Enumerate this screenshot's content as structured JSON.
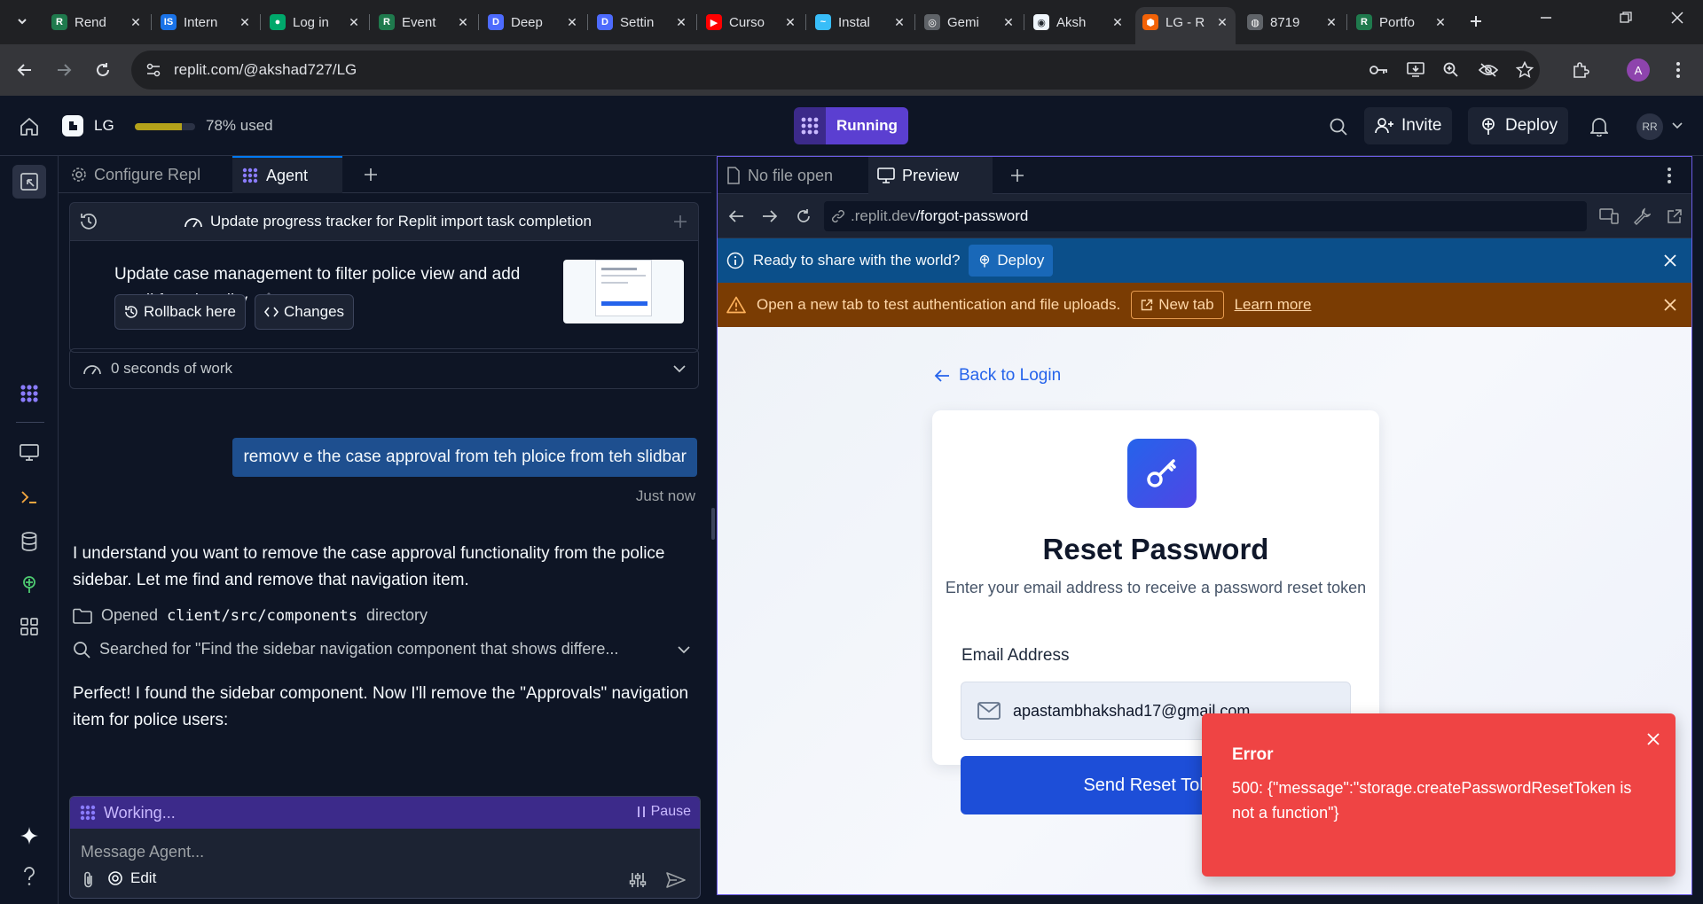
{
  "browser": {
    "tabs": [
      {
        "label": "Rend",
        "favicon_color": "#1f7a4d",
        "favicon_char": "R"
      },
      {
        "label": "Intern",
        "favicon_color": "#1a73e8",
        "favicon_char": "IS"
      },
      {
        "label": "Log in",
        "favicon_color": "#00a86b",
        "favicon_char": "●"
      },
      {
        "label": "Event",
        "favicon_color": "#1f7a4d",
        "favicon_char": "R"
      },
      {
        "label": "Deep",
        "favicon_color": "#4d6bfe",
        "favicon_char": "D"
      },
      {
        "label": "Settin",
        "favicon_color": "#4d6bfe",
        "favicon_char": "D"
      },
      {
        "label": "Curso",
        "favicon_color": "#ff0000",
        "favicon_char": "▶"
      },
      {
        "label": "Instal",
        "favicon_color": "#38bdf8",
        "favicon_char": "~"
      },
      {
        "label": "Gemi",
        "favicon_color": "#5f6368",
        "favicon_char": "◎"
      },
      {
        "label": "Aksh",
        "favicon_color": "#f0f6fc",
        "favicon_char": "◉"
      },
      {
        "label": "LG - R",
        "favicon_color": "#f26207",
        "favicon_char": "⬢",
        "active": true
      },
      {
        "label": "8719",
        "favicon_color": "#5f6368",
        "favicon_char": "◍"
      },
      {
        "label": "Portfo",
        "favicon_color": "#1f7a4d",
        "favicon_char": "R"
      }
    ],
    "url": "replit.com/@akshad727/LG",
    "profile_initial": "A"
  },
  "header": {
    "repl_name": "LG",
    "usage_percent": 78,
    "usage_text": "78% used",
    "run_label": "Running",
    "invite_label": "Invite",
    "deploy_label": "Deploy",
    "user_initials": "RR"
  },
  "left_pane": {
    "tabs": [
      {
        "label": "Configure Repl"
      },
      {
        "label": "Agent"
      }
    ],
    "top_task": "Update progress tracker for Replit import task completion",
    "checkpoint_text": "Update case management to filter police view and add scroll functionality",
    "rollback_label": "Rollback here",
    "changes_label": "Changes",
    "work_label": "0 seconds of work",
    "user_message": "removv e the case approval from teh ploice from teh slidbar",
    "message_time": "Just now",
    "agent_msg_1": "I understand you want to remove the case approval functionality from the police sidebar. Let me find and remove that navigation item.",
    "action_opened_prefix": "Opened",
    "action_opened_path": "client/src/components",
    "action_opened_suffix": "directory",
    "action_search": "Searched for \"Find the sidebar navigation component that shows differe...",
    "agent_msg_2": "Perfect! I found the sidebar component. Now I'll remove the \"Approvals\" navigation item for police users:",
    "working_label": "Working...",
    "pause_label": "Pause",
    "input_placeholder": "Message Agent...",
    "edit_label": "Edit"
  },
  "right_pane": {
    "tabs": [
      {
        "label": "No file open"
      },
      {
        "label": "Preview"
      }
    ],
    "url_prefix": ".replit.dev",
    "url_path": "/forgot-password",
    "share_text": "Ready to share with the world?",
    "share_deploy": "Deploy",
    "warn_text": "Open a new tab to test authentication and file uploads.",
    "newtab_label": "New tab",
    "learn_more": "Learn more"
  },
  "app": {
    "back_label": "Back to Login",
    "title": "Reset Password",
    "subtitle": "Enter your email address to receive a password reset token",
    "email_label": "Email Address",
    "email_value": "apastambhakshad17@gmail.com",
    "send_label": "Send Reset Token"
  },
  "toast": {
    "title": "Error",
    "body": "500: {\"message\":\"storage.createPasswordResetToken is not a function\"}"
  },
  "colors": {
    "accent_purple": "#5b3fd1",
    "error_red": "#ef4444",
    "primary_blue": "#1d4ed8",
    "share_banner": "#0b4f8a",
    "warn_banner": "#7a3c03"
  }
}
